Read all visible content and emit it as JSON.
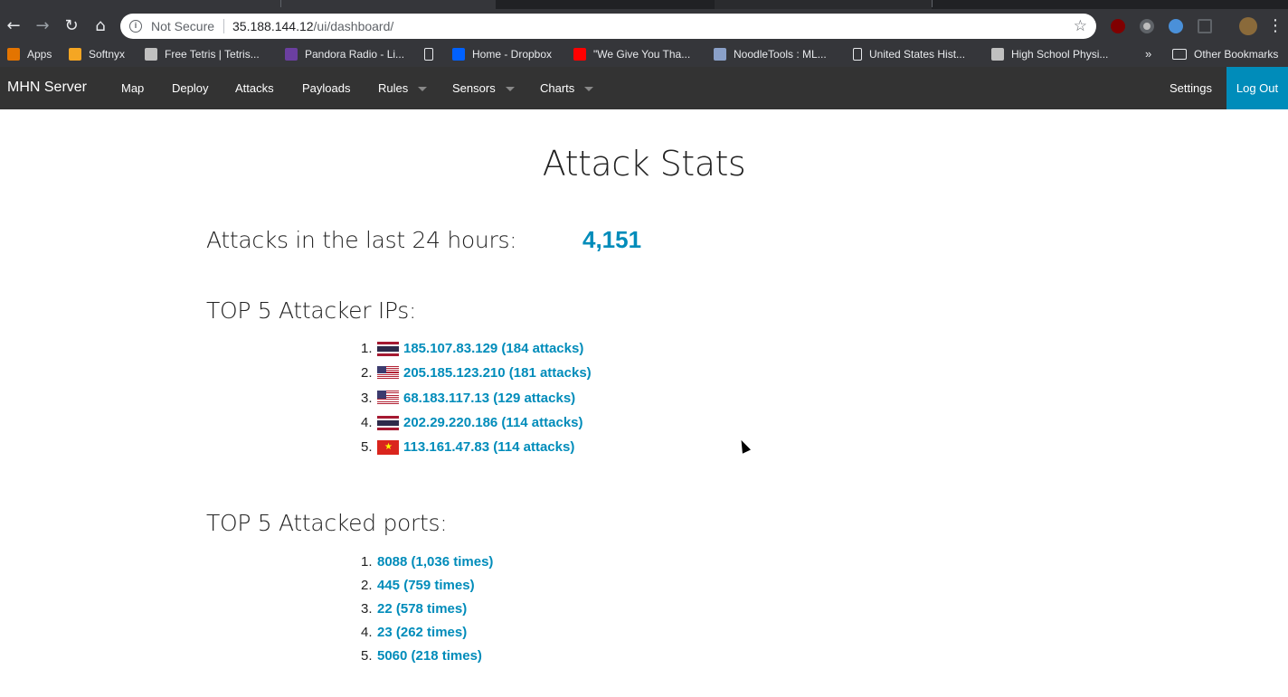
{
  "browser": {
    "omnibox": {
      "security_label": "Not Secure",
      "host": "35.188.144.12",
      "path": "/ui/dashboard/"
    },
    "bookmarks": [
      {
        "label": "Apps",
        "icon": "apps-grid-icon",
        "color": "#e37400"
      },
      {
        "label": "Softnyx",
        "icon": "softnyx-icon",
        "color": "#f5a623"
      },
      {
        "label": "Free Tetris | Tetris...",
        "icon": "tetris-icon",
        "color": "#c0c0c0"
      },
      {
        "label": "Pandora Radio - Li...",
        "icon": "pandora-icon",
        "color": "#6b3fa0"
      },
      {
        "label": "",
        "icon": "page-icon",
        "color": "#e8eaed"
      },
      {
        "label": "Home - Dropbox",
        "icon": "dropbox-icon",
        "color": "#0061ff"
      },
      {
        "label": "\"We Give You Tha...",
        "icon": "youtube-icon",
        "color": "#ff0000"
      },
      {
        "label": "NoodleTools : ML...",
        "icon": "noodletools-icon",
        "color": "#8aa0c8"
      },
      {
        "label": "United States Hist...",
        "icon": "page-icon",
        "color": "#e8eaed"
      },
      {
        "label": "High School Physi...",
        "icon": "physics-icon",
        "color": "#c0c0c0"
      }
    ],
    "bookmarks_more": "»",
    "other_bookmarks": "Other Bookmarks"
  },
  "navbar": {
    "brand": "MHN Server",
    "items": [
      {
        "label": "Map",
        "dropdown": false
      },
      {
        "label": "Deploy",
        "dropdown": false
      },
      {
        "label": "Attacks",
        "dropdown": false
      },
      {
        "label": "Payloads",
        "dropdown": false
      },
      {
        "label": "Rules",
        "dropdown": true
      },
      {
        "label": "Sensors",
        "dropdown": true
      },
      {
        "label": "Charts",
        "dropdown": true
      }
    ],
    "settings": "Settings",
    "logout": "Log Out"
  },
  "dashboard": {
    "title": "Attack Stats",
    "attacks_24h_label": "Attacks in the last 24 hours:",
    "attacks_24h_value": "4,151",
    "top_ips_heading": "TOP 5 Attacker IPs:",
    "top_ips": [
      {
        "num": "1.",
        "text": "185.107.83.129 (184 attacks)",
        "flag": "thailand"
      },
      {
        "num": "2.",
        "text": "205.185.123.210 (181 attacks)",
        "flag": "usa"
      },
      {
        "num": "3.",
        "text": "68.183.117.13 (129 attacks)",
        "flag": "usa"
      },
      {
        "num": "4.",
        "text": "202.29.220.186 (114 attacks)",
        "flag": "thailand"
      },
      {
        "num": "5.",
        "text": "113.161.47.83 (114 attacks)",
        "flag": "vietnam"
      }
    ],
    "top_ports_heading": "TOP 5 Attacked ports:",
    "top_ports": [
      {
        "num": "1.",
        "text": "8088 (1,036 times)"
      },
      {
        "num": "2.",
        "text": "445 (759 times)"
      },
      {
        "num": "3.",
        "text": "22 (578 times)"
      },
      {
        "num": "4.",
        "text": "23 (262 times)"
      },
      {
        "num": "5.",
        "text": "5060 (218 times)"
      }
    ]
  },
  "colors": {
    "accent": "#008cba",
    "navbar_bg": "#333333",
    "chrome_bg": "#35363a"
  }
}
